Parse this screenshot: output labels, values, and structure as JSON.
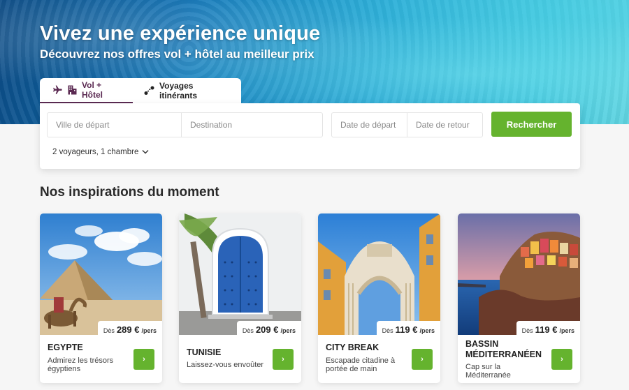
{
  "hero": {
    "title": "Vivez une expérience unique",
    "subtitle": "Découvrez nos offres vol + hôtel au meilleur prix"
  },
  "tabs": [
    {
      "label": "Vol + Hôtel",
      "icons": [
        "plane-icon",
        "hotel-icon"
      ],
      "active": true
    },
    {
      "label": "Voyages itinérants",
      "icons": [
        "route-icon"
      ],
      "active": false
    }
  ],
  "search": {
    "departure_city_placeholder": "Ville de départ",
    "destination_placeholder": "Destination",
    "departure_date_placeholder": "Date de départ",
    "return_date_placeholder": "Date de retour",
    "button_label": "Rechercher",
    "travellers_label": "2 voyageurs, 1 chambre",
    "travellers_icon": "chevron-down-icon"
  },
  "inspirations": {
    "title": "Nos inspirations du moment",
    "cards": [
      {
        "name": "EGYPTE",
        "description": "Admirez les trésors égyptiens",
        "price_prefix": "Dès",
        "price": "289 €",
        "price_suffix": "/pers",
        "button": "›"
      },
      {
        "name": "TUNISIE",
        "description": "Laissez-vous envoûter",
        "price_prefix": "Dès",
        "price": "209 €",
        "price_suffix": "/pers",
        "button": "›"
      },
      {
        "name": "CITY BREAK",
        "description": "Escapade citadine à portée de main",
        "price_prefix": "Dès",
        "price": "119 €",
        "price_suffix": "/pers",
        "button": "›"
      },
      {
        "name": "BASSIN MÉDITERRANÉEN",
        "description": "Cap sur la Méditerranée",
        "price_prefix": "Dès",
        "price": "119 €",
        "price_suffix": "/pers",
        "button": "›"
      }
    ]
  },
  "colors": {
    "accent_green": "#65b32e",
    "brand_purple": "#5b2a52"
  }
}
